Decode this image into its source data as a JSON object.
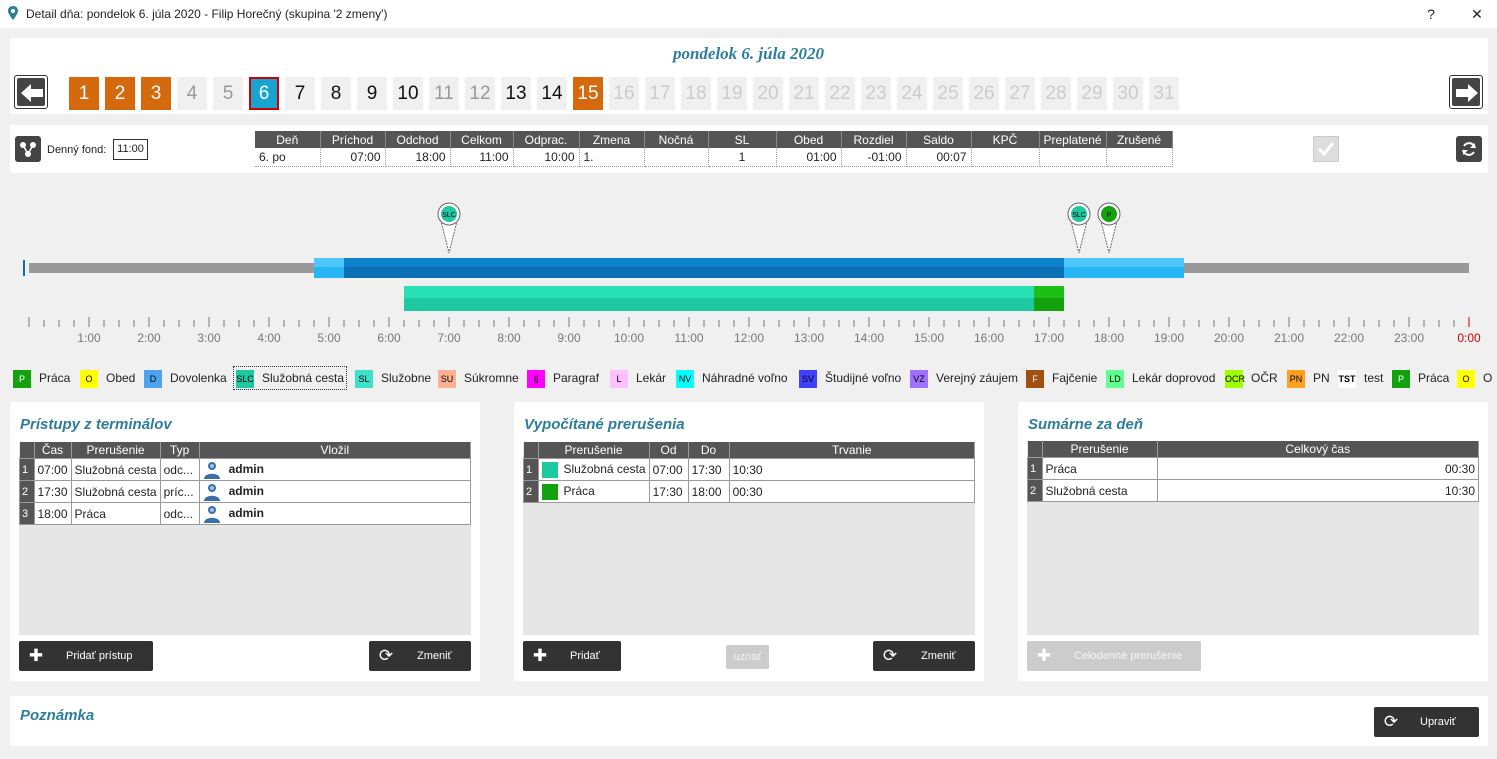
{
  "window": {
    "title": "Detail dňa: pondelok 6. júla 2020 -  Filip Horečný  (skupina '2 zmeny')",
    "help": "?",
    "close": "✕"
  },
  "date_header": "pondelok 6. júla 2020",
  "days": [
    {
      "n": "1",
      "state": "past"
    },
    {
      "n": "2",
      "state": "past"
    },
    {
      "n": "3",
      "state": "past"
    },
    {
      "n": "4",
      "state": "light"
    },
    {
      "n": "5",
      "state": "light"
    },
    {
      "n": "6",
      "state": "sel"
    },
    {
      "n": "7",
      "state": "norm"
    },
    {
      "n": "8",
      "state": "norm"
    },
    {
      "n": "9",
      "state": "norm"
    },
    {
      "n": "10",
      "state": "norm"
    },
    {
      "n": "11",
      "state": "light"
    },
    {
      "n": "12",
      "state": "light"
    },
    {
      "n": "13",
      "state": "norm"
    },
    {
      "n": "14",
      "state": "norm"
    },
    {
      "n": "15",
      "state": "past"
    },
    {
      "n": "16",
      "state": "dis"
    },
    {
      "n": "17",
      "state": "dis"
    },
    {
      "n": "18",
      "state": "dis"
    },
    {
      "n": "19",
      "state": "dis"
    },
    {
      "n": "20",
      "state": "dis"
    },
    {
      "n": "21",
      "state": "dis"
    },
    {
      "n": "22",
      "state": "dis"
    },
    {
      "n": "23",
      "state": "dis"
    },
    {
      "n": "24",
      "state": "dis"
    },
    {
      "n": "25",
      "state": "dis"
    },
    {
      "n": "26",
      "state": "dis"
    },
    {
      "n": "27",
      "state": "dis"
    },
    {
      "n": "28",
      "state": "dis"
    },
    {
      "n": "29",
      "state": "dis"
    },
    {
      "n": "30",
      "state": "dis"
    },
    {
      "n": "31",
      "state": "dis"
    }
  ],
  "summary": {
    "fund_label": "Denný fond:",
    "fund_value": "11:00",
    "headers": [
      "Deň",
      "Príchod",
      "Odchod",
      "Celkom",
      "Odprac.",
      "Zmena",
      "Nočná",
      "SL",
      "Obed",
      "Rozdiel",
      "Saldo",
      "KPČ",
      "Preplatené",
      "Zrušené"
    ],
    "row": [
      "6. po",
      "07:00",
      "18:00",
      "11:00",
      "10:00",
      "1.",
      "",
      "1",
      "01:00",
      "-01:00",
      "00:07",
      "",
      "",
      ""
    ]
  },
  "timeline": {
    "markers": [
      {
        "label": "SLC",
        "color": "#1ec8a0",
        "time": "07:00"
      },
      {
        "label": "SLC",
        "color": "#1ec8a0",
        "time": "17:30"
      },
      {
        "label": "P",
        "color": "#13a10e",
        "time": "18:00"
      }
    ],
    "hours": [
      "1:00",
      "2:00",
      "3:00",
      "4:00",
      "5:00",
      "6:00",
      "7:00",
      "8:00",
      "9:00",
      "10:00",
      "11:00",
      "12:00",
      "13:00",
      "14:00",
      "15:00",
      "16:00",
      "17:00",
      "18:00",
      "19:00",
      "20:00",
      "21:00",
      "22:00",
      "23:00",
      "0:00"
    ]
  },
  "legend": [
    {
      "code": "P",
      "label": "Práca",
      "color": "#13a10e",
      "fg": "#fff"
    },
    {
      "code": "O",
      "label": "Obed",
      "color": "#ffff00",
      "fg": "#000"
    },
    {
      "code": "D",
      "label": "Dovolenka",
      "color": "#4da3f0",
      "fg": "#000"
    },
    {
      "code": "SLC",
      "label": "Služobná cesta",
      "color": "#1ec8a0",
      "fg": "#000"
    },
    {
      "code": "SL",
      "label": "Služobne",
      "color": "#3ee0c8",
      "fg": "#000"
    },
    {
      "code": "SU",
      "label": "Súkromne",
      "color": "#ffb090",
      "fg": "#000"
    },
    {
      "code": "§",
      "label": "Paragraf",
      "color": "#ff00ff",
      "fg": "#000"
    },
    {
      "code": "L",
      "label": "Lekár",
      "color": "#ffc0ff",
      "fg": "#000"
    },
    {
      "code": "NV",
      "label": "Náhradné voľno",
      "color": "#00ffff",
      "fg": "#000"
    },
    {
      "code": "SV",
      "label": "Študijné voľno",
      "color": "#4040ff",
      "fg": "#000"
    },
    {
      "code": "VZ",
      "label": "Verejný záujem",
      "color": "#a070ff",
      "fg": "#000"
    },
    {
      "code": "F",
      "label": "Fajčenie",
      "color": "#a05010",
      "fg": "#fff"
    },
    {
      "code": "LD",
      "label": "Lekár doprovod",
      "color": "#60ff90",
      "fg": "#000"
    },
    {
      "code": "OCR",
      "label": "OČR",
      "color": "#a0ff00",
      "fg": "#000"
    },
    {
      "code": "PN",
      "label": "PN",
      "color": "#ffa020",
      "fg": "#000"
    },
    {
      "code": "TST",
      "label": "test",
      "color": "#ffffff",
      "fg": "#000"
    },
    {
      "code": "P",
      "label": "Práca",
      "color": "#13a10e",
      "fg": "#fff"
    },
    {
      "code": "O",
      "label": "O",
      "color": "#ffff00",
      "fg": "#000"
    }
  ],
  "access": {
    "title": "Prístupy z terminálov",
    "headers": [
      "Čas",
      "Prerušenie",
      "Typ",
      "Vložil"
    ],
    "rows": [
      {
        "n": "1",
        "time": "07:00",
        "type": "Služobná cesta",
        "dir": "odc...",
        "user": "admin"
      },
      {
        "n": "2",
        "time": "17:30",
        "type": "Služobná cesta",
        "dir": "príc...",
        "user": "admin"
      },
      {
        "n": "3",
        "time": "18:00",
        "type": "Práca",
        "dir": "odc...",
        "user": "admin"
      }
    ],
    "add_label": "Pridať prístup",
    "change_label": "Zmeniť"
  },
  "computed": {
    "title": "Vypočítané prerušenia",
    "headers": [
      "Prerušenie",
      "Od",
      "Do",
      "Trvanie"
    ],
    "rows": [
      {
        "n": "1",
        "color": "#1ec8a0",
        "type": "Služobná cesta",
        "from": "07:00",
        "to": "17:30",
        "dur": "10:30"
      },
      {
        "n": "2",
        "color": "#13a10e",
        "type": "Práca",
        "from": "17:30",
        "to": "18:00",
        "dur": "00:30"
      }
    ],
    "add_label": "Pridať",
    "accept_label": "uznať",
    "change_label": "Zmeniť"
  },
  "daysum": {
    "title": "Sumárne za deň",
    "headers": [
      "Prerušenie",
      "Celkový čas"
    ],
    "rows": [
      {
        "n": "1",
        "type": "Práca",
        "time": "00:30"
      },
      {
        "n": "2",
        "type": "Služobná cesta",
        "time": "10:30"
      }
    ],
    "allday_label": "Celodenné prerušenie"
  },
  "note": {
    "title": "Poznámka",
    "edit_label": "Upraviť"
  }
}
